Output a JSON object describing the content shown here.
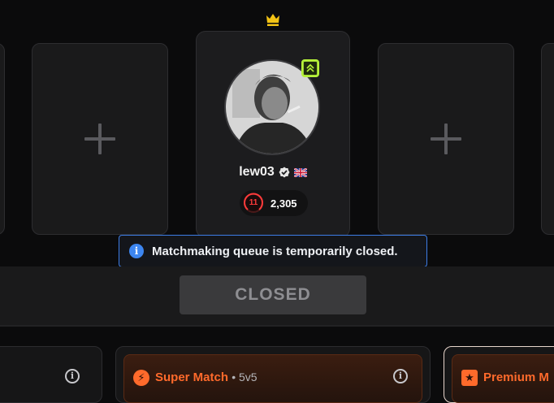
{
  "lobby": {
    "empty_slot_symbol": "+",
    "player": {
      "username": "lew03",
      "verified": true,
      "flag_icon": "uk-flag-icon",
      "skill_level": "11",
      "elo": "2,305",
      "party_leader_icon": "crown-icon",
      "rank_badge_icon": "double-chevron-up-icon"
    }
  },
  "notice": {
    "info_glyph": "i",
    "text": "Matchmaking queue is temporarily closed."
  },
  "action": {
    "button_label": "CLOSED"
  },
  "modes": [
    {
      "icon": "lightning-icon",
      "title": "",
      "subtitle": "",
      "info_glyph": "i"
    },
    {
      "icon": "lightning-icon",
      "title": "Super Match",
      "subtitle": "• 5v5",
      "info_glyph": "i"
    },
    {
      "icon": "star-icon",
      "title": "Premium M",
      "subtitle": ""
    }
  ],
  "colors": {
    "accent_orange": "#ff6a2b",
    "notice_blue": "#3d7de6",
    "rank_green": "#b6f23a",
    "elo_red": "#ff3b3b",
    "crown_gold": "#f3c315"
  }
}
